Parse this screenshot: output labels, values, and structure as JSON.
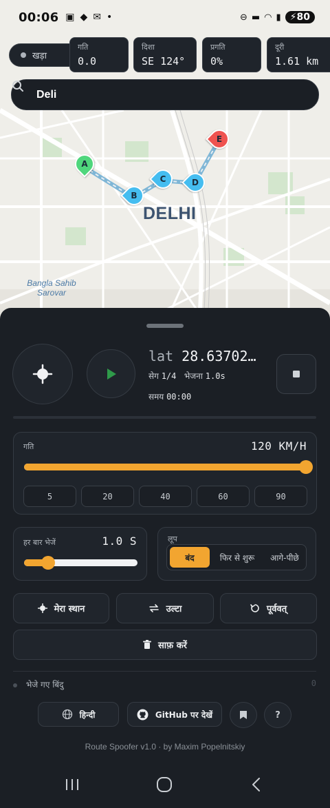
{
  "status_bar": {
    "time": "00:06",
    "battery": "80"
  },
  "state": {
    "label": "खड़ा"
  },
  "stats": [
    {
      "label": "गति",
      "value": "0.0"
    },
    {
      "label": "दिशा",
      "value": "SE 124°"
    },
    {
      "label": "प्रगति",
      "value": "0%"
    },
    {
      "label": "दूरी",
      "value": "1.61 km"
    }
  ],
  "search": {
    "value": "Deli"
  },
  "map": {
    "city_label": "DELHI",
    "poi_line1": "Bangla Sahib",
    "poi_line2": "Sarovar",
    "markers": [
      "A",
      "B",
      "C",
      "D",
      "E"
    ]
  },
  "controls": {
    "coord_key": "lat",
    "coord_value": "28.63702…",
    "segment_label": "सेग",
    "segment_value": "1/4",
    "send_label": "भेजना",
    "send_value": "1.0s",
    "time_label": "समय",
    "time_value": "00:00",
    "progress_fraction": 0
  },
  "speed": {
    "label": "गति",
    "value": "120 KM/H",
    "fraction": 1.0,
    "presets": [
      "5",
      "20",
      "40",
      "60",
      "90"
    ]
  },
  "interval": {
    "label": "हर बार भेजें",
    "value": "1.0 S",
    "fraction": 0.21
  },
  "loop": {
    "label": "लूप",
    "options": [
      "बंद",
      "फिर से शुरू",
      "आगे-पीछे"
    ],
    "selected": 0
  },
  "actions": {
    "my_location": "मेरा स्थान",
    "reverse": "उल्टा",
    "undo": "पूर्ववत्",
    "clear": "साफ़ करें"
  },
  "sent_points": {
    "label": "भेजे गए बिंदु",
    "count": "0"
  },
  "footer": {
    "language": "हिन्दी",
    "github": "GitHub पर देखें",
    "help": "?",
    "credit": "Route Spoofer v1.0 · by Maxim Popelnitskiy"
  },
  "colors": {
    "accent": "#f2a530",
    "sheet_bg": "#1b1f25",
    "panel_bg": "#1f242b",
    "marker_green": "#4fd67c",
    "marker_blue": "#45bdf0",
    "marker_red": "#ef5350",
    "route": "#7fb6d6",
    "play": "#2f9a4a"
  }
}
